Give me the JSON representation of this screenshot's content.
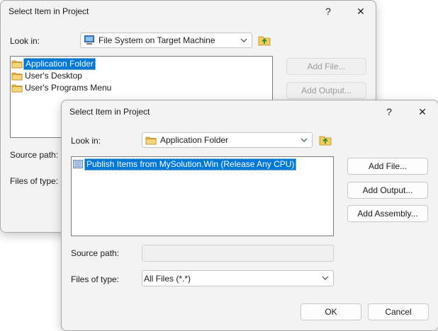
{
  "back_dialog": {
    "title": "Select Item in Project",
    "help": "?",
    "close": "✕",
    "look_in_label": "Look in:",
    "look_in_value": "File System on Target Machine",
    "items": [
      "Application Folder",
      "User's Desktop",
      "User's Programs Menu"
    ],
    "add_file": "Add File...",
    "add_output": "Add Output...",
    "source_path_label": "Source path:",
    "files_of_type_label": "Files of type:"
  },
  "front_dialog": {
    "title": "Select Item in Project",
    "help": "?",
    "close": "✕",
    "look_in_label": "Look in:",
    "look_in_value": "Application Folder",
    "items": [
      "Publish Items from MySolution.Win (Release Any CPU)"
    ],
    "add_file": "Add File...",
    "add_output": "Add Output...",
    "add_assembly": "Add Assembly...",
    "source_path_label": "Source path:",
    "source_path_value": "",
    "files_of_type_label": "Files of type:",
    "files_of_type_value": "All Files (*.*)",
    "ok": "OK",
    "cancel": "Cancel"
  },
  "colors": {
    "selection": "#0078d7",
    "dialog_bg": "#f3f3f3",
    "folder": "#e8b84a"
  }
}
